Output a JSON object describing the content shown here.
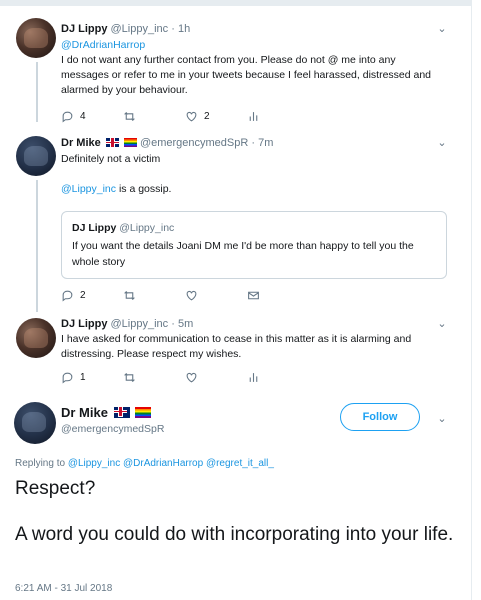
{
  "tweets": [
    {
      "name": "DJ Lippy",
      "handle": "@Lippy_inc",
      "dot": "·",
      "time": "1h",
      "mention": "@DrAdrianHarrop",
      "text": "I do not want any further contact from you. Please do not @ me into any messages or refer to me in your tweets because I feel harassed, distressed and alarmed by your behaviour.",
      "reply_count": "4",
      "retweet_count": "",
      "like_count": "2"
    },
    {
      "name": "Dr Mike",
      "handle": "@emergencymedSpR",
      "dot": "·",
      "time": "7m",
      "text_line1": "Definitely not a victim",
      "mention": "@Lippy_inc",
      "text_line2": " is a gossip.",
      "quote": {
        "name": "DJ Lippy",
        "handle": "@Lippy_inc",
        "text": "If you want the details Joani DM me I'd be more than happy to tell you the whole story"
      },
      "reply_count": "2",
      "retweet_count": "",
      "like_count": ""
    },
    {
      "name": "DJ Lippy",
      "handle": "@Lippy_inc",
      "dot": "·",
      "time": "5m",
      "text": "I have asked for communication to cease in this matter as it is alarming and distressing. Please respect my wishes.",
      "reply_count": "1",
      "retweet_count": "",
      "like_count": ""
    }
  ],
  "main_tweet": {
    "name": "Dr Mike",
    "handle": "@emergencymedSpR",
    "follow_label": "Follow",
    "replying_prefix": "Replying to",
    "replying_to": "@Lippy_inc @DrAdrianHarrop @regret_it_all_",
    "line1": "Respect?",
    "line2": "A word you could do with incorporating into your life.",
    "timestamp": "6:21 AM - 31 Jul 2018"
  },
  "colors": {
    "link": "#1b95e0",
    "follow": "#1da1f2",
    "muted": "#657786",
    "text": "#14171a"
  }
}
